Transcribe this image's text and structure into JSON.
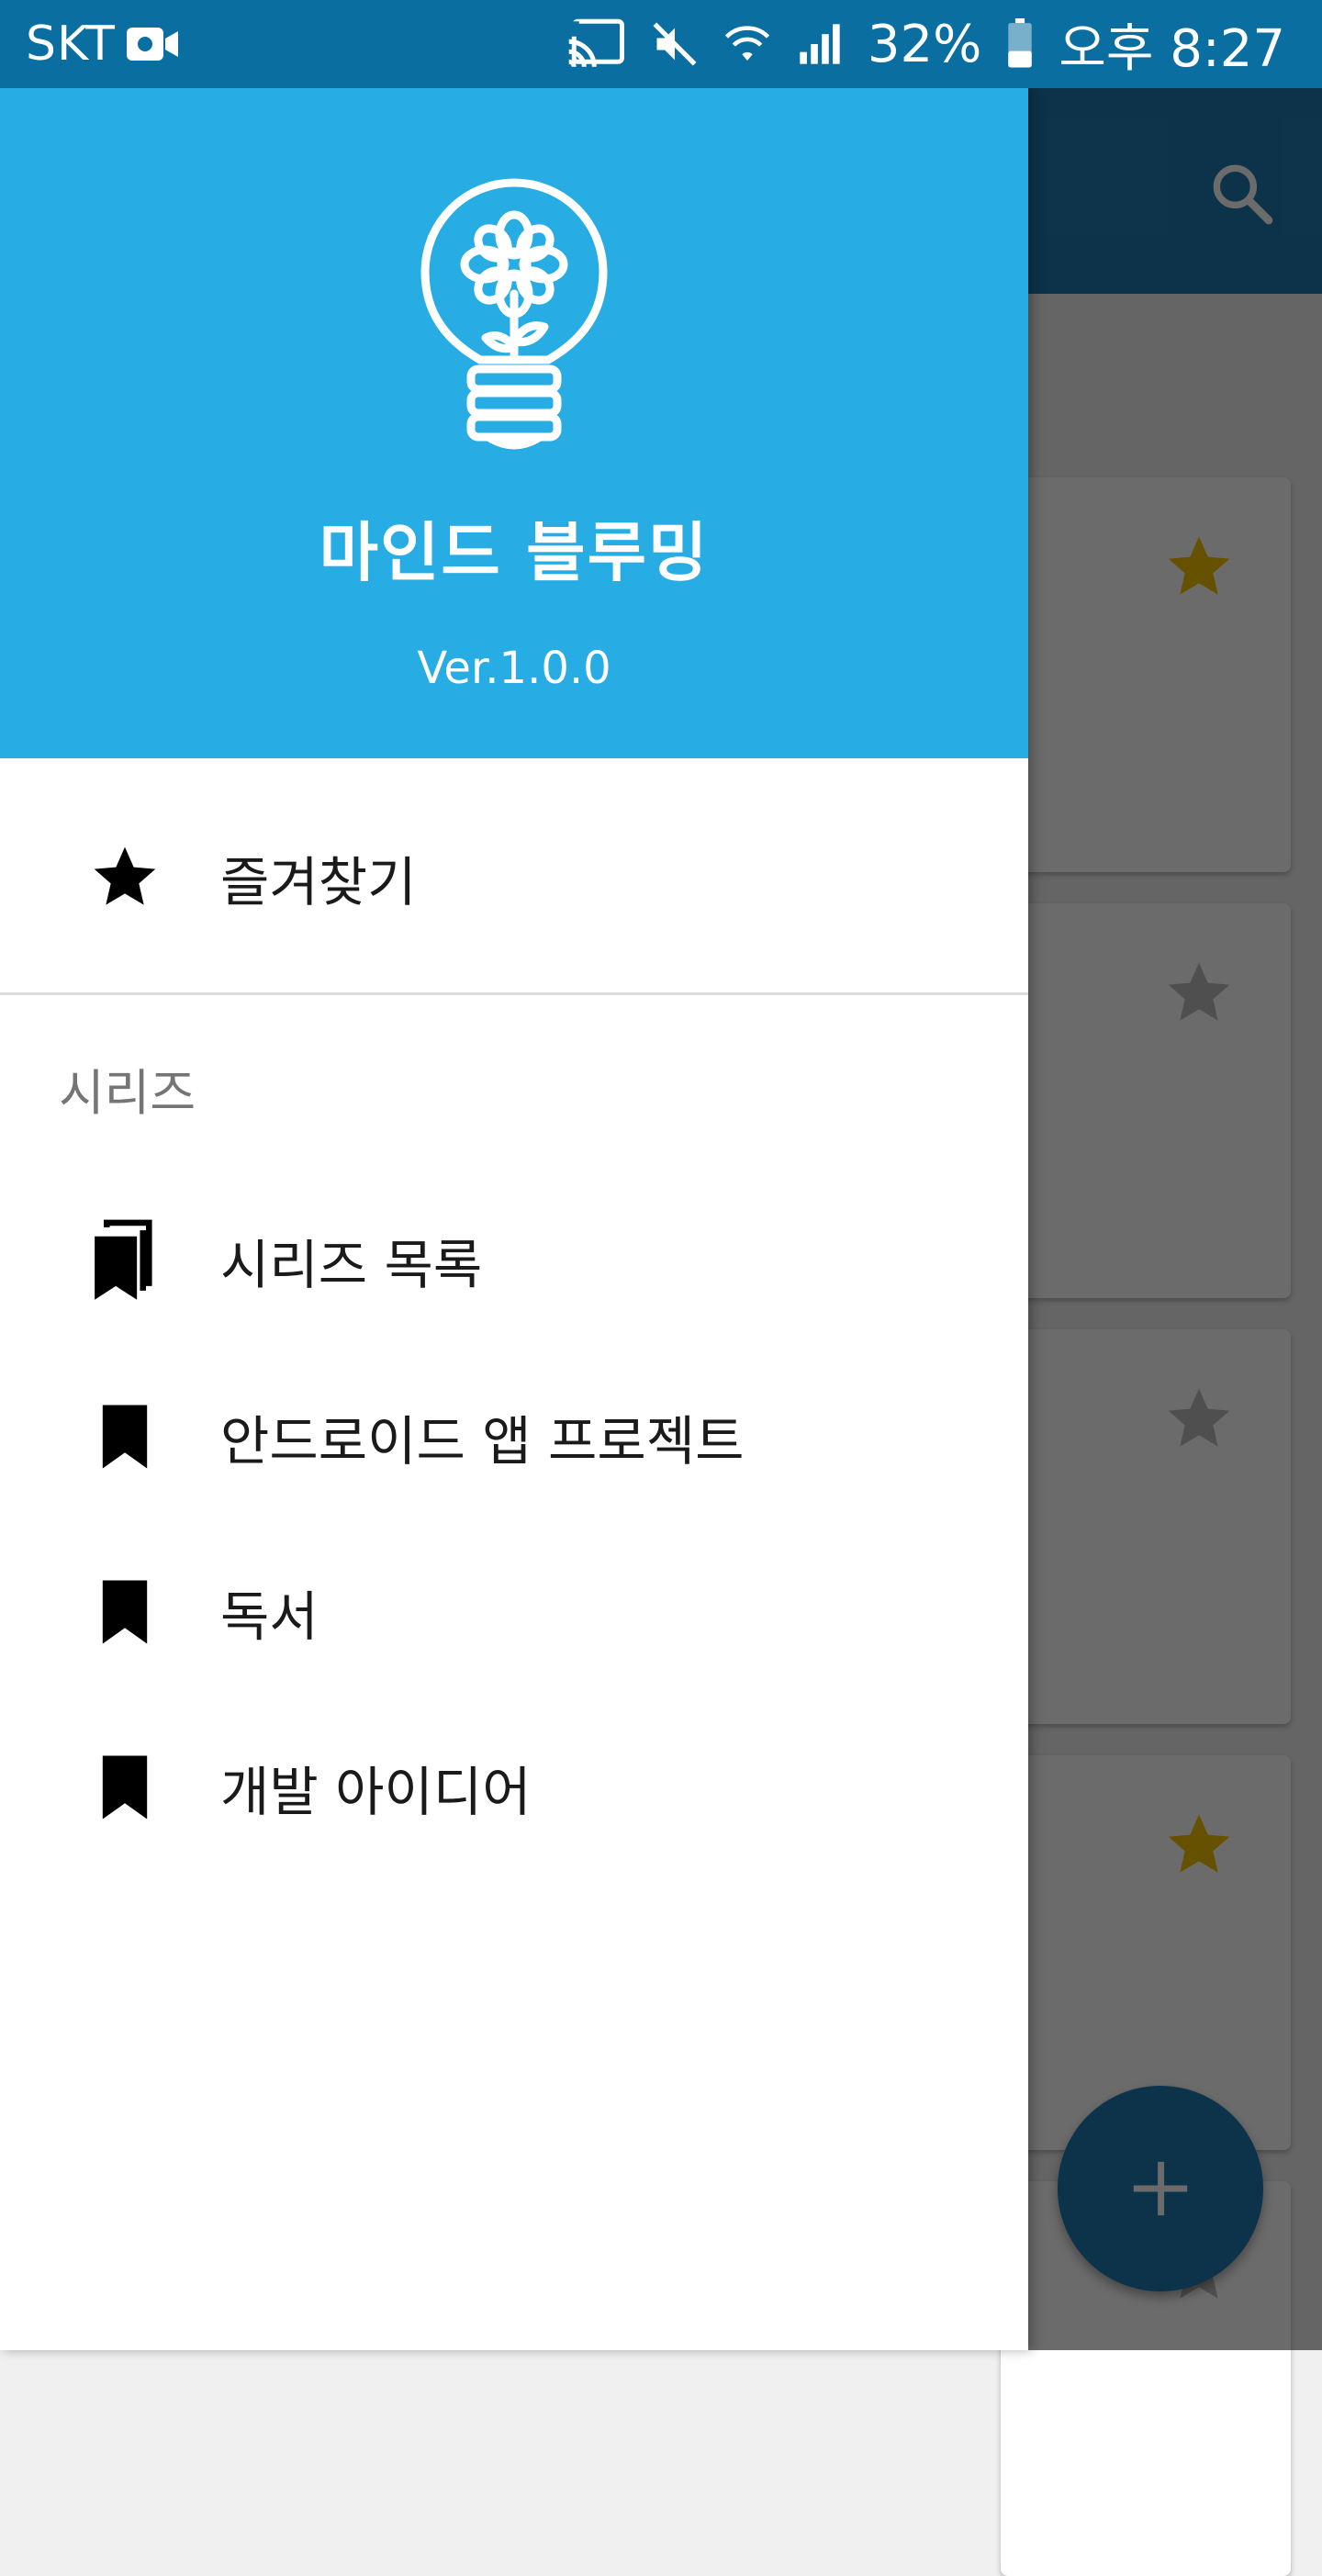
{
  "status_bar": {
    "carrier": "SKT",
    "battery": "32%",
    "time": "오후 8:27"
  },
  "drawer": {
    "app_name": "마인드 블루밍",
    "version": "Ver.1.0.0",
    "favorites_label": "즐겨찾기",
    "section_title": "시리즈",
    "series_items": [
      {
        "label": "시리즈 목록",
        "icon": "bookmarks-icon"
      },
      {
        "label": "안드로이드 앱 프로젝트",
        "icon": "bookmark-icon"
      },
      {
        "label": "독서",
        "icon": "bookmark-icon"
      },
      {
        "label": "개발 아이디어",
        "icon": "bookmark-icon"
      }
    ]
  },
  "background": {
    "cards": [
      {
        "starred": true
      },
      {
        "starred": false
      },
      {
        "starred": false
      },
      {
        "starred": true
      },
      {
        "starred": false
      }
    ]
  },
  "colors": {
    "status_bar": "#0a6fa0",
    "drawer_header": "#27ace3",
    "app_bar": "#1e7bb0",
    "star_active": "#f2c200",
    "star_inactive": "#bdbdbd"
  }
}
